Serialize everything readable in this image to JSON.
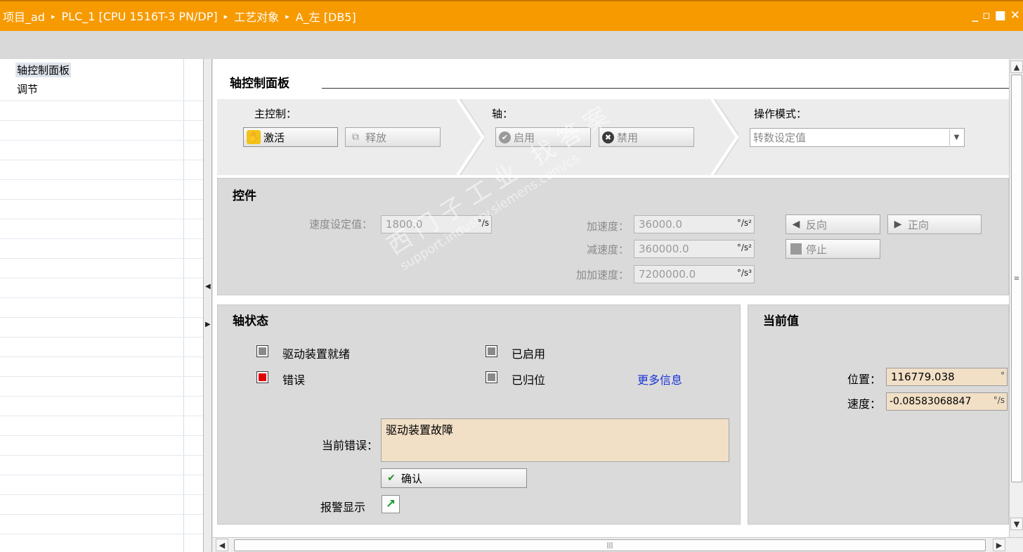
{
  "titlebar": {
    "crumbs": [
      "项目_ad",
      "PLC_1 [CPU 1516T-3 PN/DP]",
      "工艺对象",
      "A_左 [DB5]"
    ],
    "separator": "▸",
    "minimize": "_",
    "restore": "▫",
    "maximize": "■",
    "close": "✕"
  },
  "leftnav": {
    "items": [
      {
        "label": "轴控制面板",
        "selected": true
      },
      {
        "label": "调节",
        "selected": false
      }
    ]
  },
  "main": {
    "title": "轴控制面板",
    "master_control": {
      "label": "主控制：",
      "activate": "激活",
      "release": "释放"
    },
    "axis": {
      "label": "轴：",
      "enable": "启用",
      "disable": "禁用"
    },
    "operating_mode": {
      "label": "操作模式：",
      "selected": "转数设定值"
    },
    "controls": {
      "title": "控件",
      "speed_setpoint_label": "速度设定值：",
      "speed_setpoint": "1800.0",
      "speed_unit": "°/s",
      "acceleration_label": "加速度：",
      "acceleration": "36000.0",
      "acceleration_unit": "°/s²",
      "deceleration_label": "减速度：",
      "deceleration": "360000.0",
      "deceleration_unit": "°/s²",
      "jerk_label": "加加速度：",
      "jerk": "7200000.0",
      "jerk_unit": "°/s³",
      "backward": "反向",
      "forward": "正向",
      "stop": "停止"
    },
    "axis_status": {
      "title": "轴状态",
      "drive_ready": "驱动装置就绪",
      "error": "错误",
      "enabled": "已启用",
      "homed": "已归位",
      "more_info": "更多信息",
      "current_error_label": "当前错误：",
      "current_error": "驱动装置故障",
      "acknowledge": "确认",
      "alarm_display_label": "报警显示"
    },
    "current_values": {
      "title": "当前值",
      "position_label": "位置：",
      "position": "116779.038",
      "position_unit": "°",
      "velocity_label": "速度：",
      "velocity": "-0.08583068847",
      "velocity_unit": "°/s"
    }
  },
  "watermark": {
    "line1": "西门子工业 找答案",
    "line2": "support.industry.siemens.com/cs"
  },
  "colors": {
    "titlebar": "#f79a00",
    "error_indicator": "#e00000",
    "link": "#1a34d6",
    "value_field": "#f1dfc6"
  }
}
